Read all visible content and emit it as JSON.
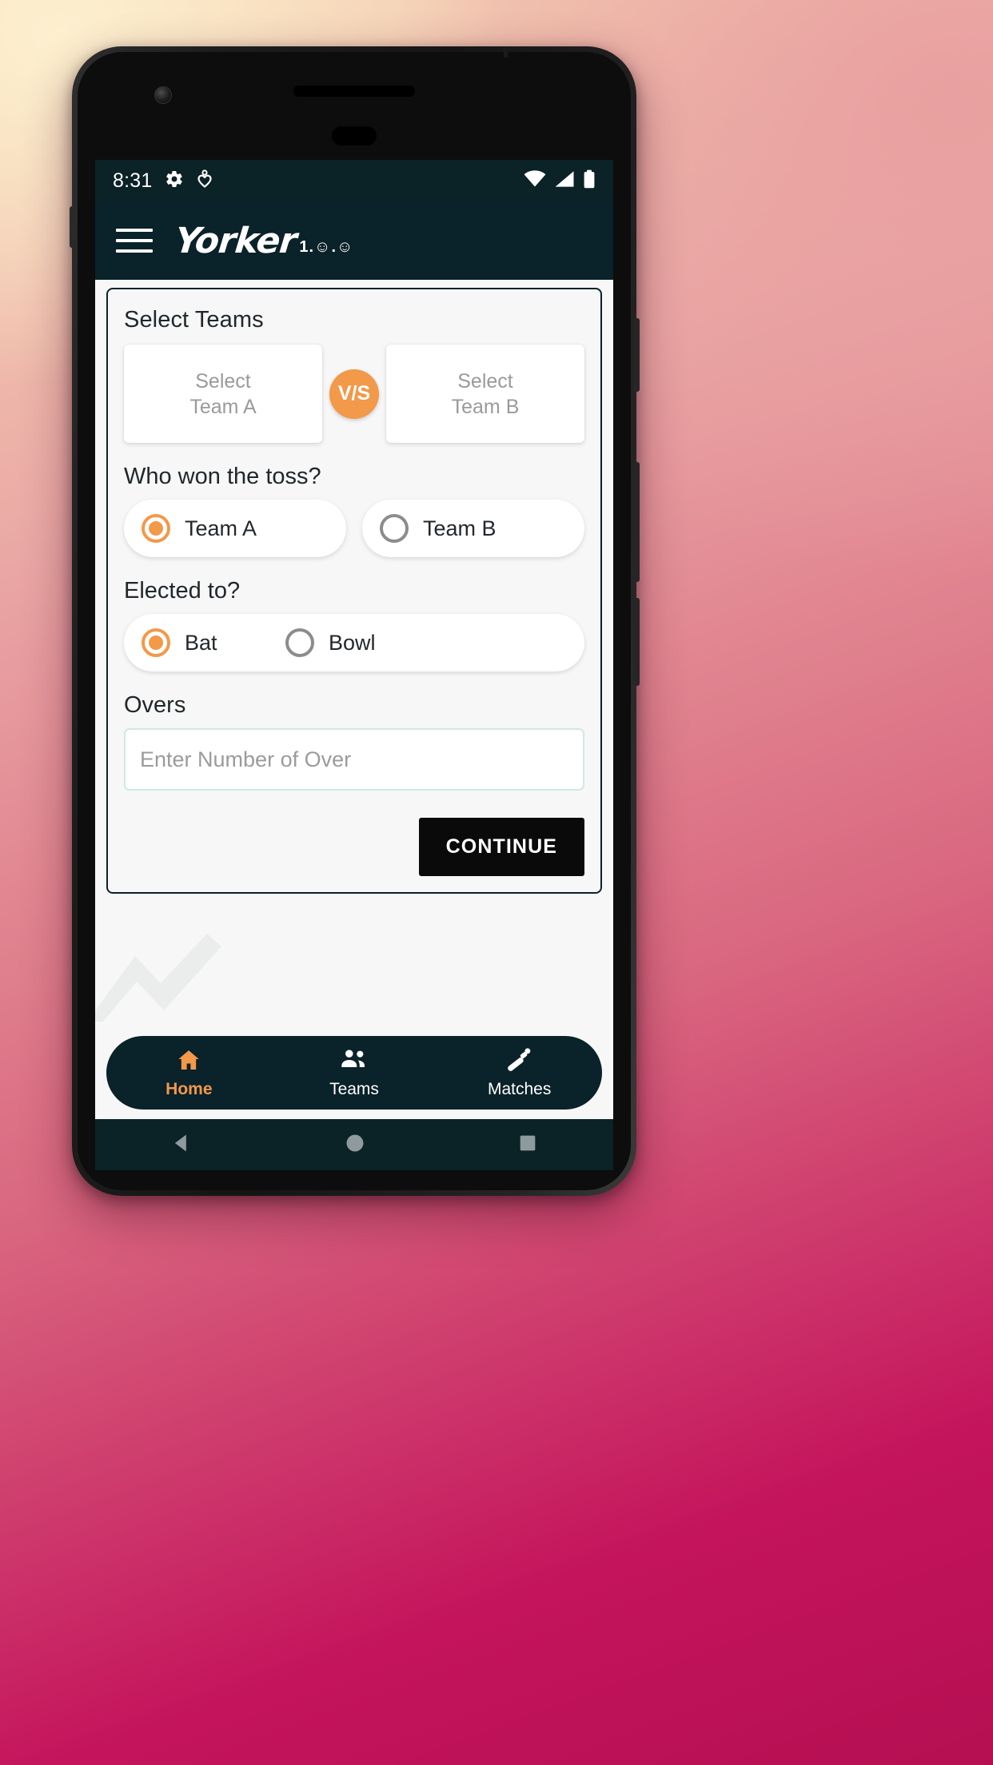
{
  "status_bar": {
    "time": "8:31",
    "icons_left": [
      "gear-icon",
      "location-heart-icon"
    ],
    "icons_right": [
      "wifi-icon",
      "signal-icon",
      "battery-icon"
    ]
  },
  "app_bar": {
    "menu_icon": "hamburger-menu-icon",
    "brand": "Yorker",
    "version": "1.☺.☺"
  },
  "card": {
    "select_teams_label": "Select Teams",
    "team_a_line1": "Select",
    "team_a_line2": "Team A",
    "team_b_line1": "Select",
    "team_b_line2": "Team B",
    "vs_badge": "V/S",
    "toss_question": "Who won the toss?",
    "toss_options": [
      {
        "label": "Team A",
        "selected": true
      },
      {
        "label": "Team B",
        "selected": false
      }
    ],
    "elected_question": "Elected to?",
    "elected_options": [
      {
        "label": "Bat",
        "selected": true
      },
      {
        "label": "Bowl",
        "selected": false
      }
    ],
    "overs_label": "Overs",
    "overs_placeholder": "Enter Number of Over",
    "overs_value": "",
    "continue_label": "CONTINUE"
  },
  "bottom_nav": [
    {
      "label": "Home",
      "icon": "home-icon",
      "active": true
    },
    {
      "label": "Teams",
      "icon": "people-icon",
      "active": false
    },
    {
      "label": "Matches",
      "icon": "cricket-bat-icon",
      "active": false
    }
  ],
  "android_nav": {
    "back": "back-triangle-icon",
    "home": "home-circle-icon",
    "recents": "recents-square-icon"
  },
  "colors": {
    "accent_orange": "#f2994a",
    "dark_teal": "#0a2229",
    "status_bar": "#0b2227",
    "page_bg": "#f7f7f7"
  }
}
